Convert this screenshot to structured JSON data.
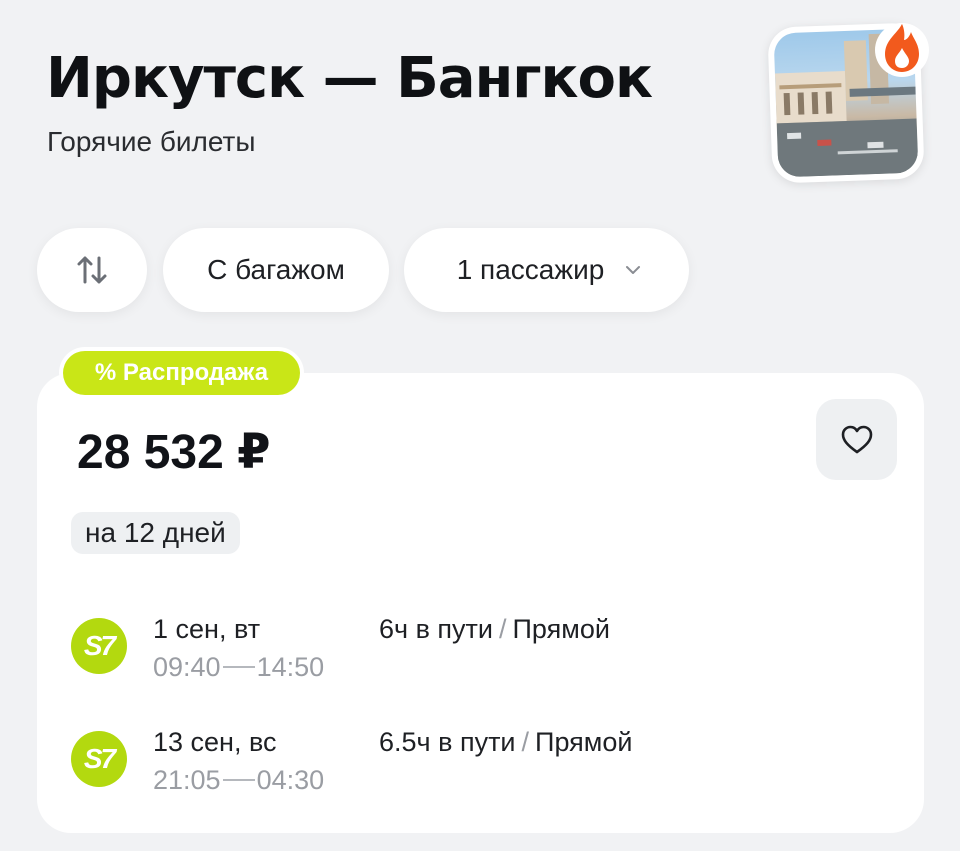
{
  "header": {
    "title": "Иркутск — Бангкок",
    "subtitle": "Горячие билеты"
  },
  "filters": {
    "swap_icon": "swap-vertical-icon",
    "baggage_label": "С багажом",
    "passengers_label": "1 пассажир"
  },
  "offer": {
    "badge": "% Распродажа",
    "price": "28 532 ₽",
    "duration_badge": "на 12 дней",
    "favorite_icon": "heart-icon",
    "accent_color": "#c9e617",
    "flights": [
      {
        "airline_logo": "S7",
        "date": "1 сен, вт",
        "depart": "09:40",
        "arrive": "14:50",
        "travel_time": "6ч в пути",
        "type": "Прямой"
      },
      {
        "airline_logo": "S7",
        "date": "13 сен, вс",
        "depart": "21:05",
        "arrive": "04:30",
        "travel_time": "6.5ч в пути",
        "type": "Прямой"
      }
    ]
  }
}
